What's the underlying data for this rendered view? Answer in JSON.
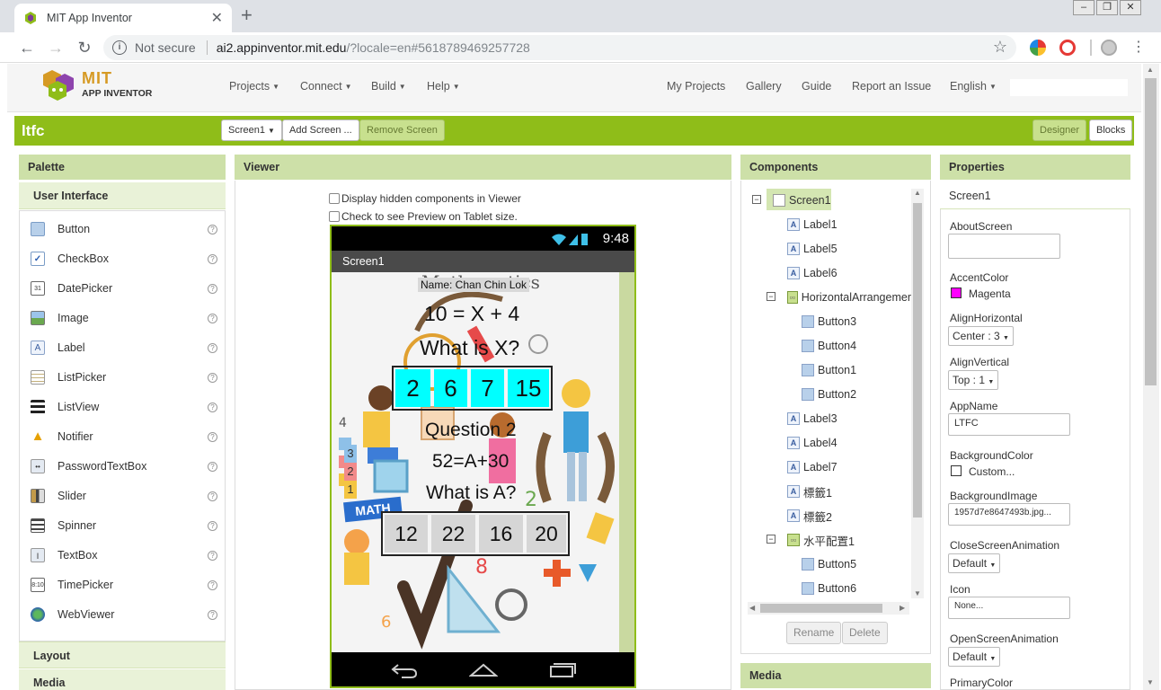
{
  "browser": {
    "tab_title": "MIT App Inventor",
    "tab_close": "✕",
    "new_tab": "+",
    "security_label": "Not secure",
    "url_host": "ai2.appinventor.mit.edu",
    "url_path": "/?locale=en#5618789469257728"
  },
  "header": {
    "logo_mit": "MIT",
    "logo_app": "APP INVENTOR",
    "menus": [
      "Projects",
      "Connect",
      "Build",
      "Help"
    ],
    "links": [
      "My Projects",
      "Gallery",
      "Guide",
      "Report an Issue",
      "English"
    ]
  },
  "project": {
    "name": "ltfc",
    "screen_select": "Screen1",
    "add_screen": "Add Screen ...",
    "remove_screen": "Remove Screen",
    "designer": "Designer",
    "blocks": "Blocks"
  },
  "palette": {
    "title": "Palette",
    "section": "User Interface",
    "items": [
      "Button",
      "CheckBox",
      "DatePicker",
      "Image",
      "Label",
      "ListPicker",
      "ListView",
      "Notifier",
      "PasswordTextBox",
      "Slider",
      "Spinner",
      "TextBox",
      "TimePicker",
      "WebViewer"
    ],
    "sections_below": [
      "Layout",
      "Media"
    ]
  },
  "viewer": {
    "title": "Viewer",
    "chk_hidden": "Display hidden components in Viewer",
    "chk_tablet": "Check to see Preview on Tablet size.",
    "phone": {
      "time": "9:48",
      "screen_title": "Screen1",
      "name_label": "Name: Chan Chin Lok",
      "eq1": "10 = X + 4",
      "q1": "What is X?",
      "answers1": [
        "2",
        "6",
        "7",
        "15"
      ],
      "question2": "Question 2",
      "eq2": "52=A+30",
      "q2": "What is A?",
      "answers2": [
        "12",
        "22",
        "16",
        "20"
      ],
      "math_sign": "MATH"
    }
  },
  "components": {
    "title": "Components",
    "tree": [
      {
        "label": "Screen1",
        "level": 0
      },
      {
        "label": "Label1",
        "level": 1
      },
      {
        "label": "Label5",
        "level": 1
      },
      {
        "label": "Label6",
        "level": 1
      },
      {
        "label": "HorizontalArrangemer",
        "level": 1
      },
      {
        "label": "Button3",
        "level": 2
      },
      {
        "label": "Button4",
        "level": 2
      },
      {
        "label": "Button1",
        "level": 2
      },
      {
        "label": "Button2",
        "level": 2
      },
      {
        "label": "Label3",
        "level": 1
      },
      {
        "label": "Label4",
        "level": 1
      },
      {
        "label": "Label7",
        "level": 1
      },
      {
        "label": "標籤1",
        "level": 1
      },
      {
        "label": "標籤2",
        "level": 1
      },
      {
        "label": "水平配置1",
        "level": 1
      },
      {
        "label": "Button5",
        "level": 2
      },
      {
        "label": "Button6",
        "level": 2
      }
    ],
    "rename": "Rename",
    "delete": "Delete",
    "media_title": "Media"
  },
  "properties": {
    "title": "Properties",
    "component": "Screen1",
    "about_label": "AboutScreen",
    "accent_label": "AccentColor",
    "accent_value": "Magenta",
    "accent_color": "#ff00ff",
    "alignh_label": "AlignHorizontal",
    "alignh_value": "Center : 3",
    "alignv_label": "AlignVertical",
    "alignv_value": "Top : 1",
    "appname_label": "AppName",
    "appname_value": "LTFC",
    "bgcolor_label": "BackgroundColor",
    "bgcolor_value": "Custom...",
    "bgimage_label": "BackgroundImage",
    "bgimage_value": "1957d7e8647493b.jpg...",
    "closeanim_label": "CloseScreenAnimation",
    "closeanim_value": "Default",
    "icon_label": "Icon",
    "icon_value": "None...",
    "openanim_label": "OpenScreenAnimation",
    "openanim_value": "Default",
    "primary_label": "PrimaryColor"
  },
  "colors": {
    "green_bar": "#8fbd19",
    "panel_header": "#cde0a8",
    "answer_cyan": "#00ffff",
    "answer_gray": "#d6d6d6"
  }
}
